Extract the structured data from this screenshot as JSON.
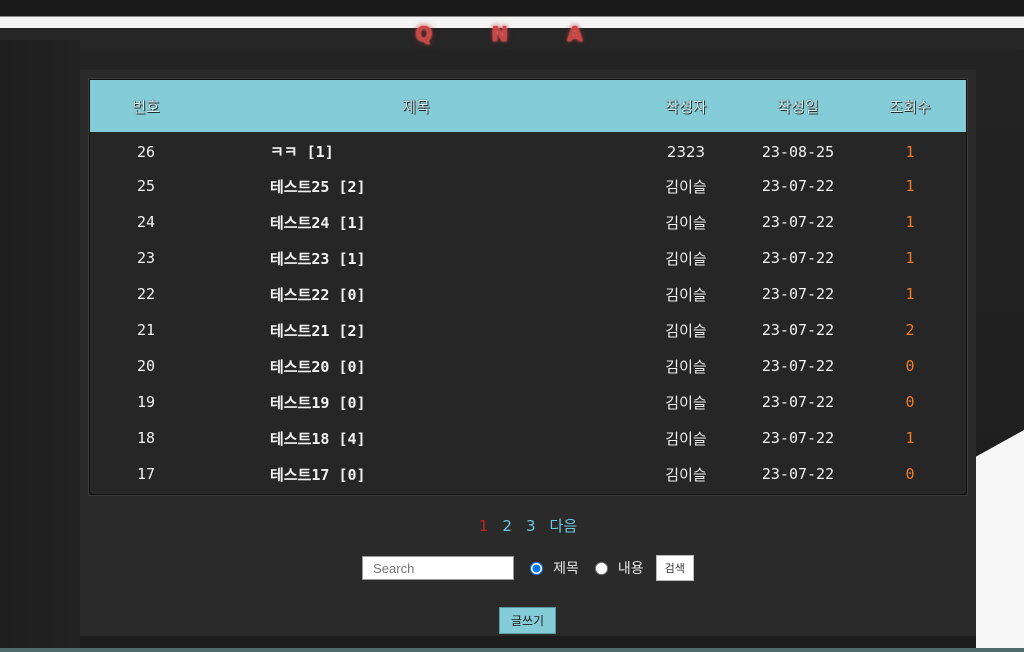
{
  "title": "Q N A",
  "table": {
    "headers": [
      "번호",
      "제목",
      "작성자",
      "작성일",
      "조회수"
    ],
    "rows": [
      {
        "num": "26",
        "subject": "ㅋㅋ [1]",
        "author": "2323",
        "date": "23-08-25",
        "views": "1"
      },
      {
        "num": "25",
        "subject": "테스트25 [2]",
        "author": "김이슬",
        "date": "23-07-22",
        "views": "1"
      },
      {
        "num": "24",
        "subject": "테스트24 [1]",
        "author": "김이슬",
        "date": "23-07-22",
        "views": "1"
      },
      {
        "num": "23",
        "subject": "테스트23 [1]",
        "author": "김이슬",
        "date": "23-07-22",
        "views": "1"
      },
      {
        "num": "22",
        "subject": "테스트22 [0]",
        "author": "김이슬",
        "date": "23-07-22",
        "views": "1"
      },
      {
        "num": "21",
        "subject": "테스트21 [2]",
        "author": "김이슬",
        "date": "23-07-22",
        "views": "2"
      },
      {
        "num": "20",
        "subject": "테스트20 [0]",
        "author": "김이슬",
        "date": "23-07-22",
        "views": "0"
      },
      {
        "num": "19",
        "subject": "테스트19 [0]",
        "author": "김이슬",
        "date": "23-07-22",
        "views": "0"
      },
      {
        "num": "18",
        "subject": "테스트18 [4]",
        "author": "김이슬",
        "date": "23-07-22",
        "views": "1"
      },
      {
        "num": "17",
        "subject": "테스트17 [0]",
        "author": "김이슬",
        "date": "23-07-22",
        "views": "0"
      }
    ]
  },
  "pagination": {
    "pages": [
      "1",
      "2",
      "3"
    ],
    "current": "1",
    "next_label": "다음"
  },
  "search": {
    "placeholder": "Search",
    "value": "",
    "options": [
      {
        "label": "제목",
        "checked": true
      },
      {
        "label": "내용",
        "checked": false
      }
    ],
    "button_label": "검색"
  },
  "write_button_label": "글쓰기",
  "colors": {
    "header_bg": "#84ccd7",
    "views": "#f07c2c",
    "current_page": "#c42020",
    "page_link": "#6cc8e0",
    "title": "#c44"
  }
}
